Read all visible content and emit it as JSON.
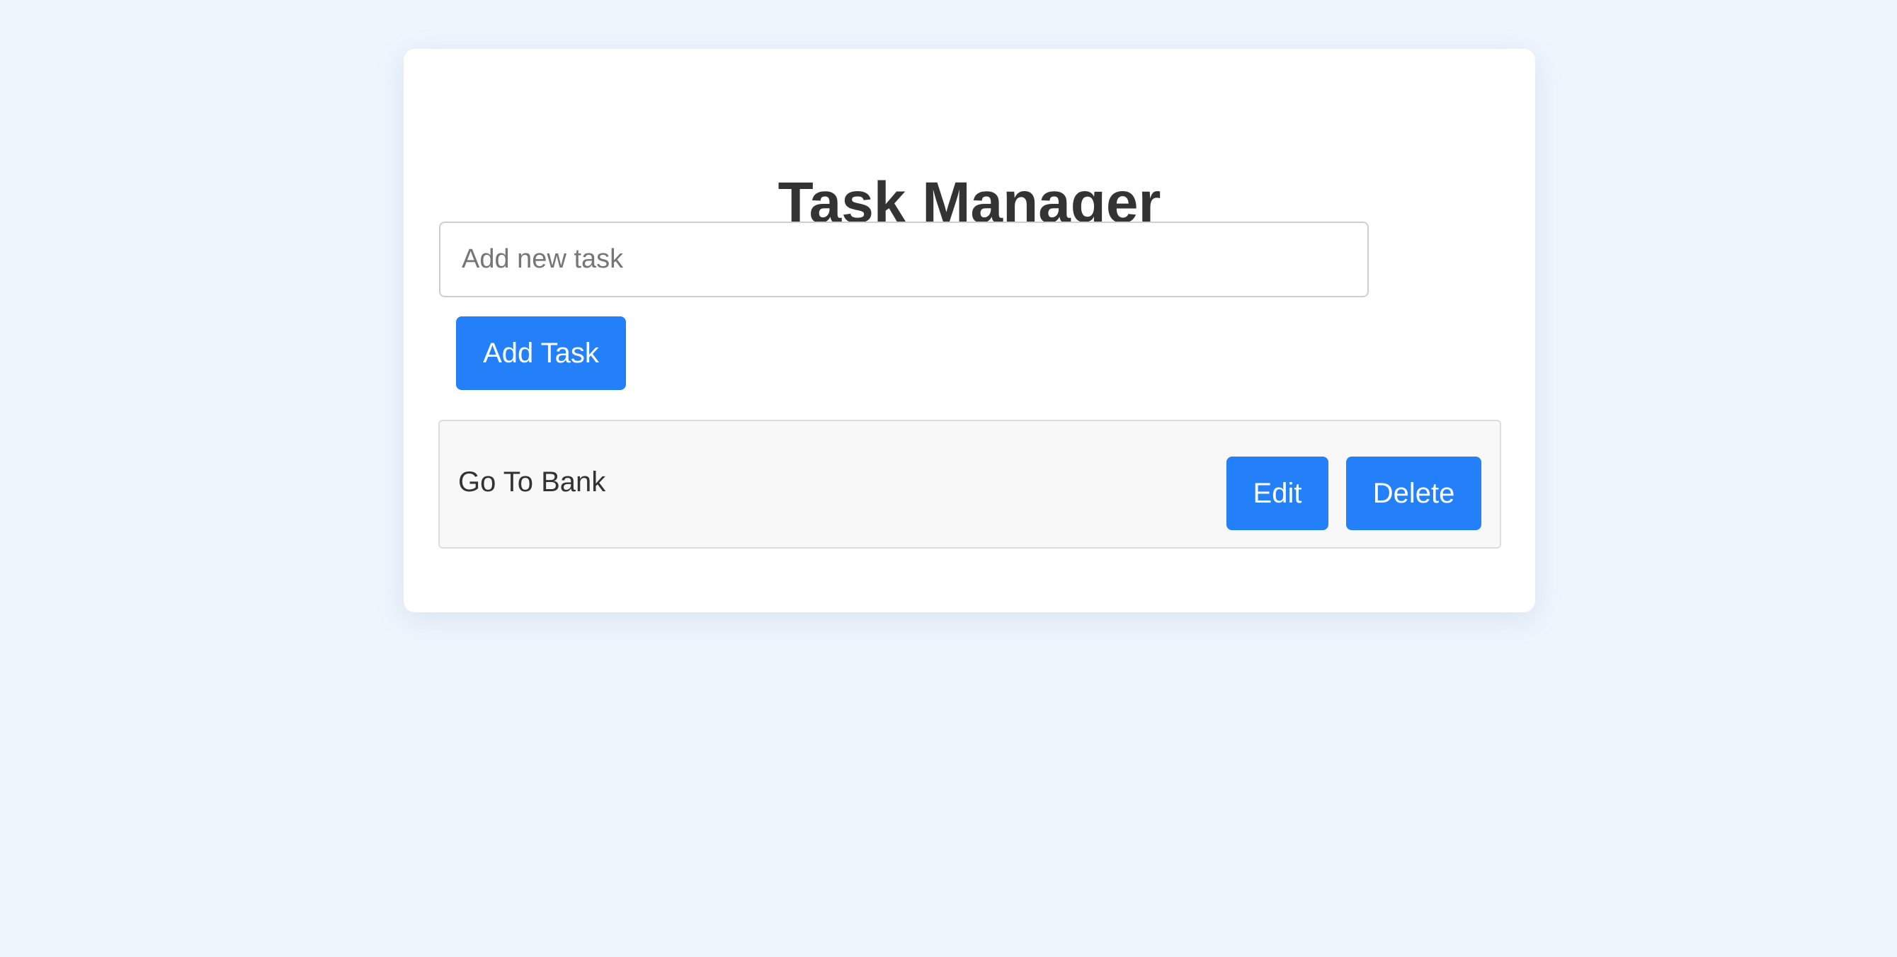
{
  "app": {
    "title": "Task Manager"
  },
  "input": {
    "placeholder": "Add new task",
    "value": ""
  },
  "buttons": {
    "add_label": "Add Task"
  },
  "tasks": [
    {
      "text": "Go To Bank",
      "edit_label": "Edit",
      "delete_label": "Delete"
    }
  ],
  "colors": {
    "background": "#eef5fd",
    "card": "#ffffff",
    "accent": "#2380f8",
    "task_item_bg": "#f8f8f8",
    "text": "#333333"
  }
}
